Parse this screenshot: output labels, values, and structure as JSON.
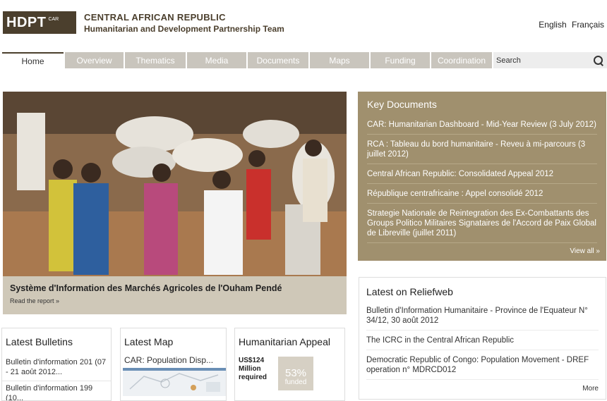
{
  "header": {
    "logo_text": "HDPT",
    "logo_sub": "CAR",
    "org_line1": "CENTRAL AFRICAN REPUBLIC",
    "org_line2": "Humanitarian and Development Partnership Team",
    "lang_en": "English",
    "lang_fr": "Français"
  },
  "nav": {
    "items": [
      {
        "label": "Home"
      },
      {
        "label": "Overview"
      },
      {
        "label": "Thematics"
      },
      {
        "label": "Media"
      },
      {
        "label": "Documents"
      },
      {
        "label": "Maps"
      },
      {
        "label": "Funding"
      },
      {
        "label": "Coordination"
      }
    ],
    "search_placeholder": "Search"
  },
  "hero": {
    "title": "Système d'Information des Marchés Agricoles de l'Ouham Pendé",
    "link": "Read the report »",
    "photo_icon": "photo-image"
  },
  "key_documents": {
    "title": "Key Documents",
    "items": [
      {
        "label": "CAR: Humanitarian Dashboard - Mid-Year Review (3 July 2012)"
      },
      {
        "label": "RCA : Tableau du bord humanitaire - Reveu à mi-parcours (3 juillet 2012)"
      },
      {
        "label": "Central African Republic: Consolidated Appeal 2012"
      },
      {
        "label": "République centrafricaine : Appel consolidé 2012"
      },
      {
        "label": "Strategie Nationale de Reintegration des Ex-Combattants des Groups Politico Militaires Signataires de l'Accord de Paix Global de Libreville (juillet 2011)"
      }
    ],
    "view_all": "View all »"
  },
  "reliefweb": {
    "title": "Latest on Reliefweb",
    "items": [
      {
        "label": "Bulletin d'Information Humanitaire - Province de l'Equateur N° 34/12, 30 août 2012"
      },
      {
        "label": "The ICRC in the Central African Republic"
      },
      {
        "label": "Democratic Republic of Congo: Population Movement - DREF operation n° MDRCD012"
      }
    ],
    "more": "More"
  },
  "bulletins": {
    "title": "Latest Bulletins",
    "items": [
      {
        "label": "Bulletin d'information 201 (07 - 21 août 2012..."
      },
      {
        "label": "Bulletin d'information 199 (10..."
      }
    ]
  },
  "latest_map": {
    "title": "Latest Map",
    "map_title": "CAR: Population Disp..."
  },
  "appeal": {
    "title": "Humanitarian Appeal",
    "amount": "US$124 Million required",
    "percent": "53%",
    "percent_label": "funded",
    "funded_fraction": 0.53
  },
  "colors": {
    "brand": "#4b3f2d",
    "nav_bg": "#c9c5bd",
    "key_docs_bg": "#a0906e",
    "caption_bg": "#cfc8b8"
  }
}
